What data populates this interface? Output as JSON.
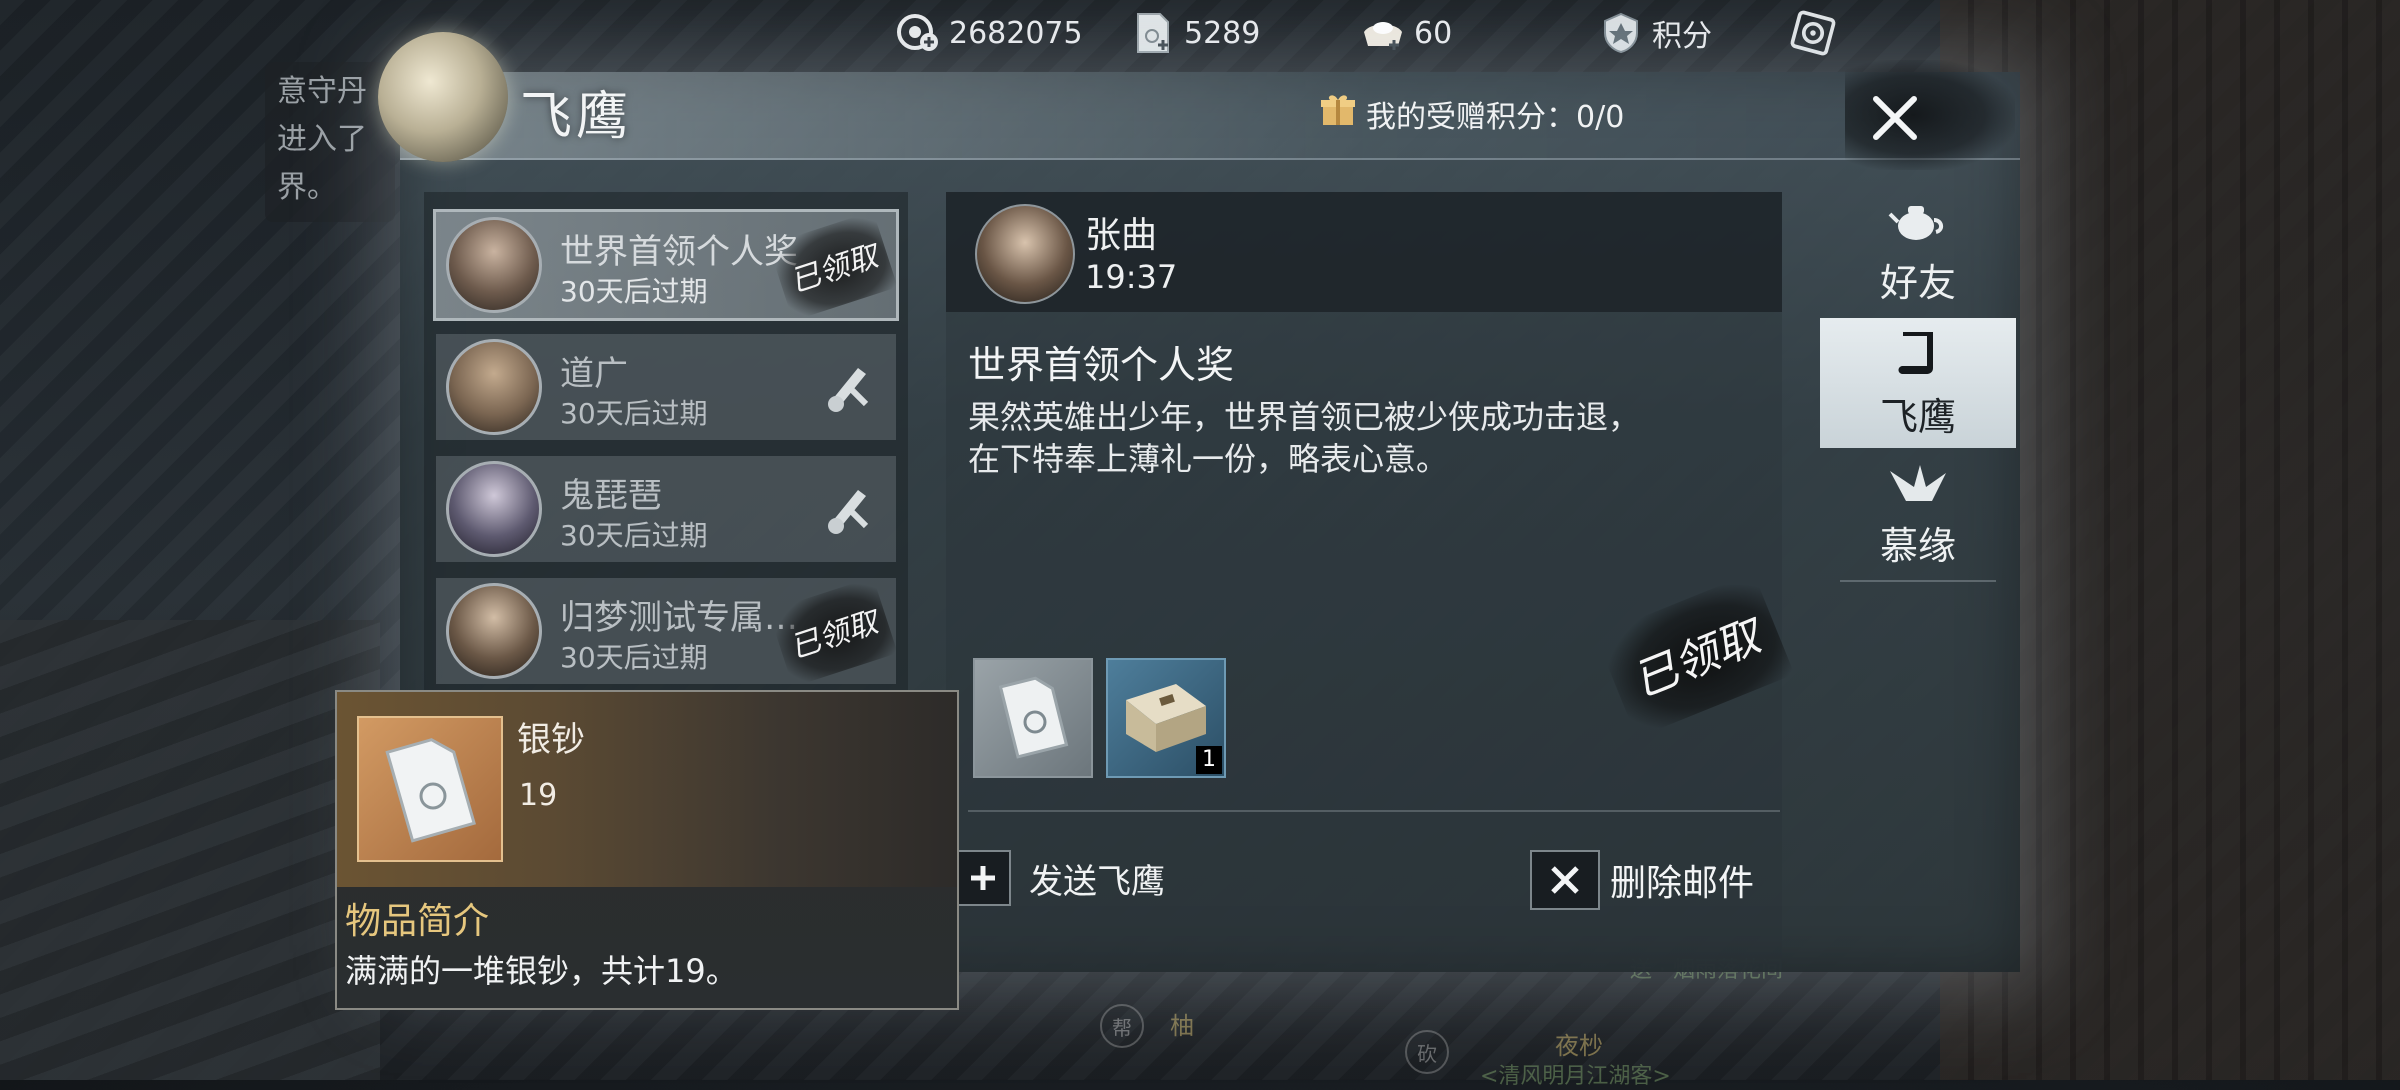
{
  "background": {
    "chat_preview": "意守丹进入了界。",
    "player_names": [
      {
        "name": "柚",
        "badge": "帮"
      },
      {
        "name": "夜杪",
        "badge": "砍",
        "tag": "<清风明月江湖客>"
      }
    ],
    "faint_name": "送 · 烟雨落花间"
  },
  "topbar": {
    "currency1_value": "2682075",
    "currency2_value": "5289",
    "currency3_value": "60",
    "points_label": "积分"
  },
  "panel": {
    "title": "飞鹰",
    "gift_points_label": "我的受赠积分：0/0"
  },
  "mail_list": [
    {
      "name": "世界首领个人奖",
      "expiry": "30天后过期",
      "claimed_label": "已领取"
    },
    {
      "name": "道广",
      "expiry": "30天后过期"
    },
    {
      "name": "鬼琵琶",
      "expiry": "30天后过期"
    },
    {
      "name": "归梦测试专属…",
      "expiry": "30天后过期",
      "claimed_label": "已领取"
    }
  ],
  "detail": {
    "sender": "张曲",
    "time": "19:37",
    "subject": "世界首领个人奖",
    "body_line1": "果然英雄出少年，世界首领已被少侠成功击退，",
    "body_line2": "在下特奉上薄礼一份，略表心意。",
    "claimed_stamp": "已领取",
    "attachment2_count": "1",
    "send_label": "发送飞鹰",
    "delete_label": "删除邮件"
  },
  "tabs": [
    {
      "label": "好友",
      "icon": "teapot-icon"
    },
    {
      "label": "飞鹰",
      "icon": "scroll-icon"
    },
    {
      "label": "慕缘",
      "icon": "paper-crane-icon"
    }
  ],
  "tooltip": {
    "item_name": "银钞",
    "quantity": "19",
    "section_title": "物品简介",
    "description": "满满的一堆银钞，共计19。"
  },
  "colors": {
    "accent_gold": "#e6c77e",
    "panel_bg": "#34404a",
    "tab_active": "#dde4e8"
  }
}
